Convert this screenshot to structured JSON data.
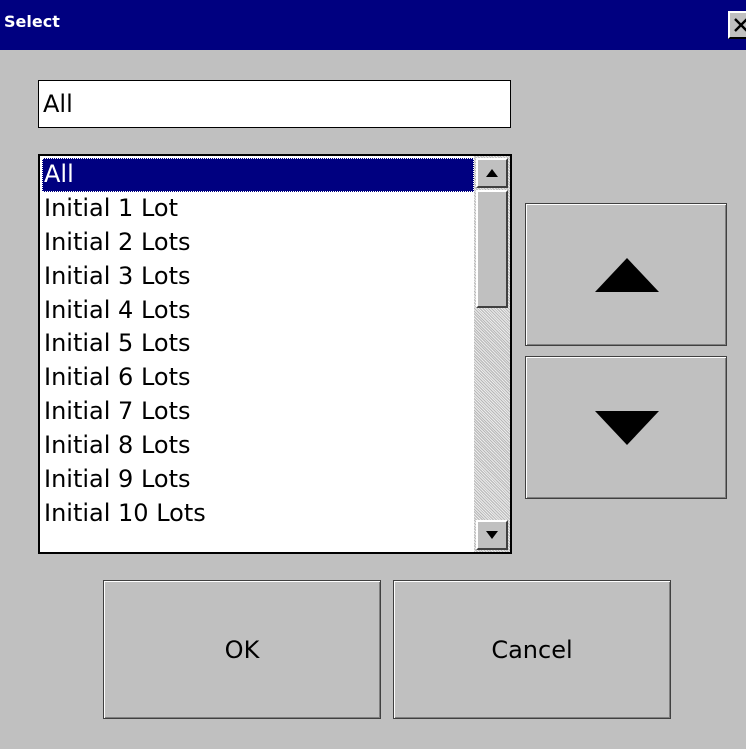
{
  "window": {
    "title": "Select"
  },
  "filter": {
    "value": "All"
  },
  "list": {
    "items": [
      "All",
      "Initial 1 Lot",
      "Initial 2 Lots",
      "Initial 3 Lots",
      "Initial 4 Lots",
      "Initial 5 Lots",
      "Initial 6 Lots",
      "Initial 7 Lots",
      "Initial 8 Lots",
      "Initial 9 Lots",
      "Initial 10 Lots"
    ],
    "selected_index": 0
  },
  "buttons": {
    "ok": "OK",
    "cancel": "Cancel"
  },
  "icons": {
    "close": "close-icon",
    "scroll_up": "scroll-up-arrow-icon",
    "scroll_down": "scroll-down-arrow-icon",
    "move_up": "up-triangle-icon",
    "move_down": "down-triangle-icon"
  },
  "colors": {
    "titlebar": "#000080",
    "selection": "#000080",
    "background": "#c0c0c0"
  }
}
